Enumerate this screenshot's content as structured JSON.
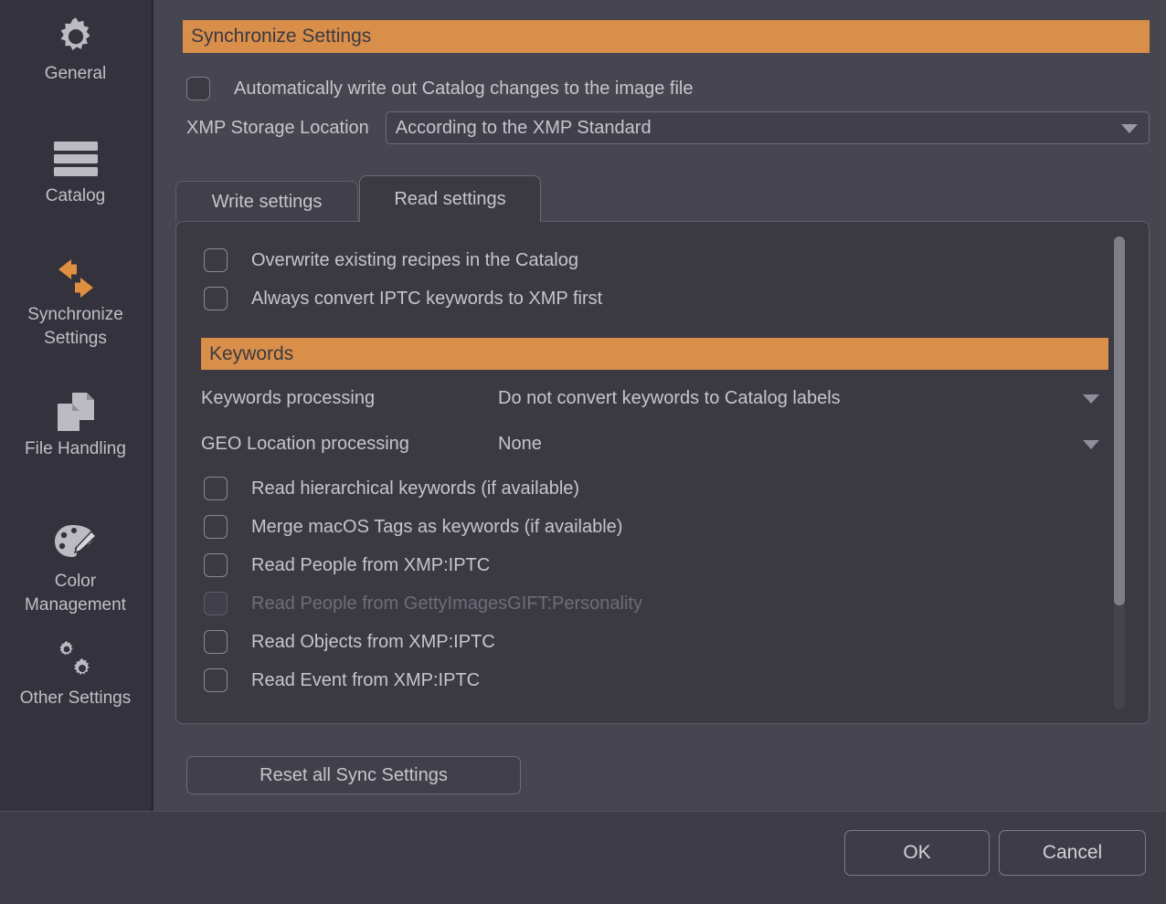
{
  "sidebar": {
    "items": [
      {
        "label": "General",
        "icon": "gear-icon"
      },
      {
        "label": "Catalog",
        "icon": "stacked-bars-icon"
      },
      {
        "label": "Synchronize\nSettings",
        "icon": "sync-arrows-icon",
        "selected": true
      },
      {
        "label": "File Handling",
        "icon": "documents-icon"
      },
      {
        "label": "Color\nManagement",
        "icon": "palette-icon"
      },
      {
        "label": "Other Settings",
        "icon": "double-gear-icon"
      }
    ]
  },
  "main": {
    "title": "Synchronize Settings",
    "auto_write_label": "Automatically write out Catalog changes to the image file",
    "auto_write_checked": false,
    "xmp_storage_label": "XMP Storage Location",
    "xmp_storage_value": "According to the XMP Standard",
    "tabs": [
      {
        "label": "Write settings",
        "active": false
      },
      {
        "label": "Read settings",
        "active": true
      }
    ],
    "read_settings": {
      "top_checkboxes": [
        {
          "label": "Overwrite existing recipes in the Catalog",
          "checked": false,
          "disabled": false
        },
        {
          "label": "Always convert IPTC keywords to XMP first",
          "checked": false,
          "disabled": false
        }
      ],
      "keywords_header": "Keywords",
      "selects": [
        {
          "label": "Keywords processing",
          "value": "Do not convert keywords to Catalog labels"
        },
        {
          "label": "GEO Location processing",
          "value": "None"
        }
      ],
      "option_checkboxes": [
        {
          "label": "Read hierarchical keywords (if available)",
          "checked": false,
          "disabled": false
        },
        {
          "label": "Merge macOS Tags as keywords (if available)",
          "checked": false,
          "disabled": false
        },
        {
          "label": "Read People from XMP:IPTC",
          "checked": false,
          "disabled": false
        },
        {
          "label": "Read People from GettyImagesGIFT:Personality",
          "checked": false,
          "disabled": true
        },
        {
          "label": "Read Objects from XMP:IPTC",
          "checked": false,
          "disabled": false
        },
        {
          "label": "Read Event from XMP:IPTC",
          "checked": false,
          "disabled": false
        }
      ]
    },
    "reset_button": "Reset all Sync Settings"
  },
  "footer": {
    "ok_label": "OK",
    "cancel_label": "Cancel"
  },
  "colors": {
    "accent_orange": "#d98e4a",
    "panel_bg": "#3b3a42",
    "main_bg": "#47454f",
    "sidebar_bg": "#34323c",
    "footer_bg": "#3e3c46",
    "text": "#c6c5cc",
    "text_disabled": "#6e6c78"
  }
}
